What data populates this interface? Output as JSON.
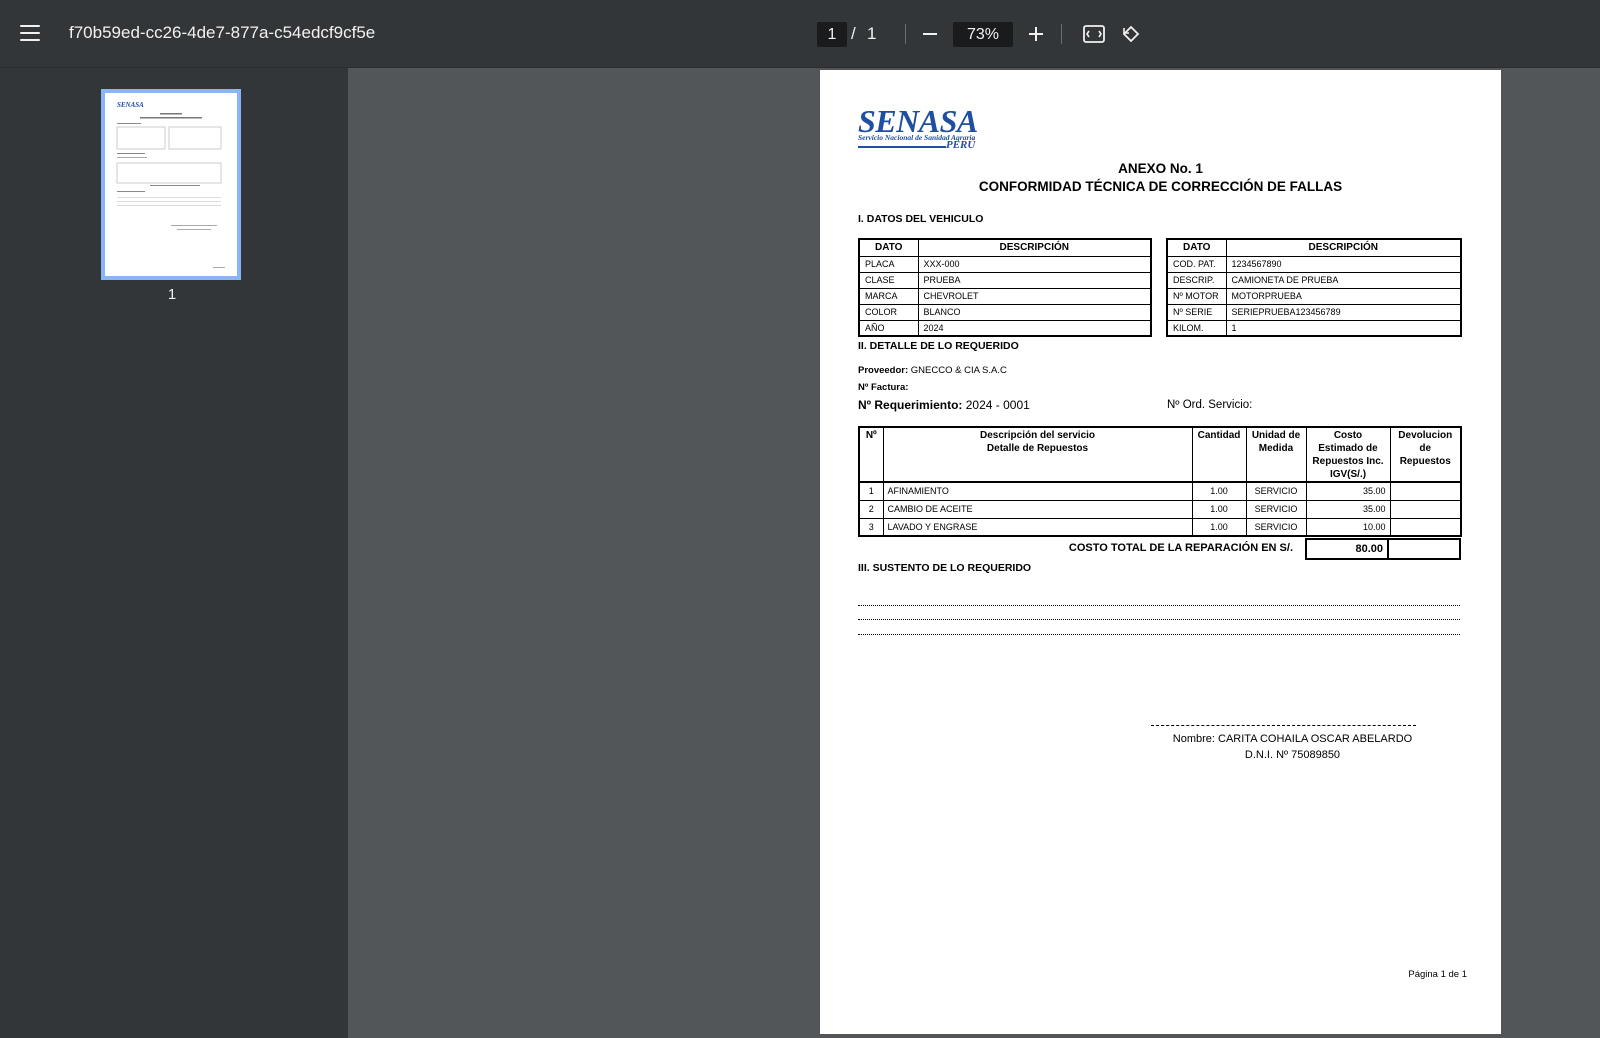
{
  "toolbar": {
    "title": "f70b59ed-cc26-4de7-877a-c54edcf9cf5e",
    "page_current": "1",
    "page_separator": "/",
    "page_total": "1",
    "zoom": "73%"
  },
  "sidebar": {
    "thumbnails": [
      {
        "label": "1"
      }
    ]
  },
  "document": {
    "logo": {
      "name": "SENASA",
      "subtitle": "Servicio Nacional de Sanidad Agraria",
      "country": "PERÚ"
    },
    "heading1": "ANEXO No. 1",
    "heading2": "CONFORMIDAD TÉCNICA DE CORRECCIÓN DE FALLAS",
    "section1_title": "I. DATOS DEL VEHICULO",
    "vehicle_headers": {
      "dato": "DATO",
      "descripcion": "DESCRIPCIÓN"
    },
    "vehicle_left": [
      {
        "dato": "PLACA",
        "desc": "XXX-000"
      },
      {
        "dato": "CLASE",
        "desc": "PRUEBA"
      },
      {
        "dato": "MARCA",
        "desc": "CHEVROLET"
      },
      {
        "dato": "COLOR",
        "desc": "BLANCO"
      },
      {
        "dato": "AÑO",
        "desc": "2024"
      }
    ],
    "vehicle_right": [
      {
        "dato": "COD. PAT.",
        "desc": "1234567890"
      },
      {
        "dato": "DESCRIP.",
        "desc": "CAMIONETA DE PRUEBA"
      },
      {
        "dato": "Nº MOTOR",
        "desc": "MOTORPRUEBA"
      },
      {
        "dato": "Nº SERIE",
        "desc": "SERIEPRUEBA123456789"
      },
      {
        "dato": "KILOM.",
        "desc": "1"
      }
    ],
    "section2_title": "II. DETALLE DE LO REQUERIDO",
    "proveedor_label": "Proveedor:",
    "proveedor_value": "GNECCO & CIA S.A.C",
    "factura_label": "Nº Factura:",
    "requerimiento_label": "Nº Requerimiento:",
    "requerimiento_value": "2024 - 0001",
    "ord_servicio_label": "Nº Ord. Servicio:",
    "req_headers": {
      "num": "Nº",
      "desc_line1": "Descripción del servicio",
      "desc_line2": "Detalle de Repuestos",
      "cantidad": "Cantidad",
      "unidad_line1": "Unidad de",
      "unidad_line2": "Medida",
      "costo_line1": "Costo",
      "costo_line2": "Estimado de",
      "costo_line3": "Repuestos Inc.",
      "costo_line4": "IGV(S/.)",
      "dev_line1": "Devolucion",
      "dev_line2": "de",
      "dev_line3": "Repuestos"
    },
    "req_rows": [
      {
        "num": "1",
        "desc": "AFINAMIENTO",
        "cantidad": "1.00",
        "unidad": "SERVICIO",
        "costo": "35.00",
        "dev": ""
      },
      {
        "num": "2",
        "desc": "CAMBIO DE ACEITE",
        "cantidad": "1.00",
        "unidad": "SERVICIO",
        "costo": "35.00",
        "dev": ""
      },
      {
        "num": "3",
        "desc": "LAVADO Y ENGRASE",
        "cantidad": "1.00",
        "unidad": "SERVICIO",
        "costo": "10.00",
        "dev": ""
      }
    ],
    "total_label": "COSTO TOTAL DE LA REPARACIÓN EN S/.",
    "total_value": "80.00",
    "section3_title": "III. SUSTENTO DE LO REQUERIDO",
    "signature_name": "Nombre:  CARITA COHAILA OSCAR ABELARDO",
    "signature_dni": "D.N.I. Nº  75089850",
    "footer": "Página 1 de 1"
  },
  "colors": {
    "toolbar_bg": "#323639",
    "viewer_bg": "#525659",
    "thumb_border": "#8ab4f8",
    "logo_blue": "#1e4fa0"
  }
}
